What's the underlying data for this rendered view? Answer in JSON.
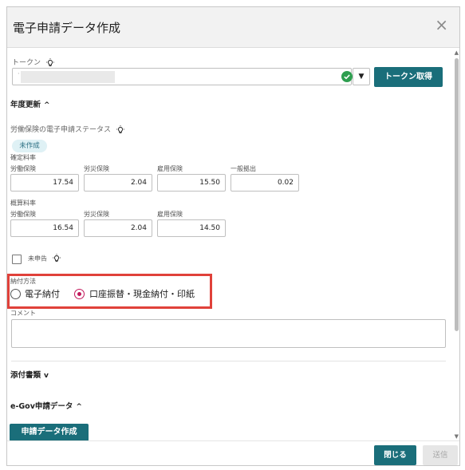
{
  "dialog": {
    "title": "電子申請データ作成",
    "close_glyph": "×"
  },
  "token": {
    "label": "トークン",
    "masked_prefix": "·",
    "dropdown_glyph": "▼",
    "get_button": "トークン取得"
  },
  "annual_update": {
    "heading": "年度更新",
    "toggle": "^",
    "status_label": "労働保険の電子申請ステータス",
    "status_badge": "未作成",
    "confirmed": {
      "title": "確定料率",
      "fields": [
        {
          "label": "労働保険",
          "value": "17.54"
        },
        {
          "label": "労災保険",
          "value": "2.04"
        },
        {
          "label": "雇用保険",
          "value": "15.50"
        },
        {
          "label": "一般拠出",
          "value": "0.02"
        }
      ]
    },
    "estimated": {
      "title": "概算料率",
      "fields": [
        {
          "label": "労働保険",
          "value": "16.54"
        },
        {
          "label": "労災保険",
          "value": "2.04"
        },
        {
          "label": "雇用保険",
          "value": "14.50"
        }
      ]
    },
    "not_declared_label": "未申告"
  },
  "payment": {
    "label": "納付方法",
    "options": [
      {
        "label": "電子納付",
        "selected": false
      },
      {
        "label": "口座振替・現金納付・印紙",
        "selected": true
      }
    ]
  },
  "comment": {
    "label": "コメント",
    "value": ""
  },
  "attachments": {
    "heading": "添付書類",
    "toggle": "v"
  },
  "egov": {
    "heading": "e-Gov申請データ",
    "toggle": "^",
    "create_button": "申請データ作成"
  },
  "footer": {
    "close_button": "閉じる",
    "send_button": "送信"
  },
  "colors": {
    "accent": "#1a6e7a",
    "selected_radio": "#c2185b",
    "highlight": "#e0413a",
    "badge_bg": "#dff1f5",
    "check_green": "#2e9e4f"
  },
  "icons": {
    "bulb": "lightbulb-icon",
    "check": "check-circle-icon",
    "close": "close-icon"
  }
}
